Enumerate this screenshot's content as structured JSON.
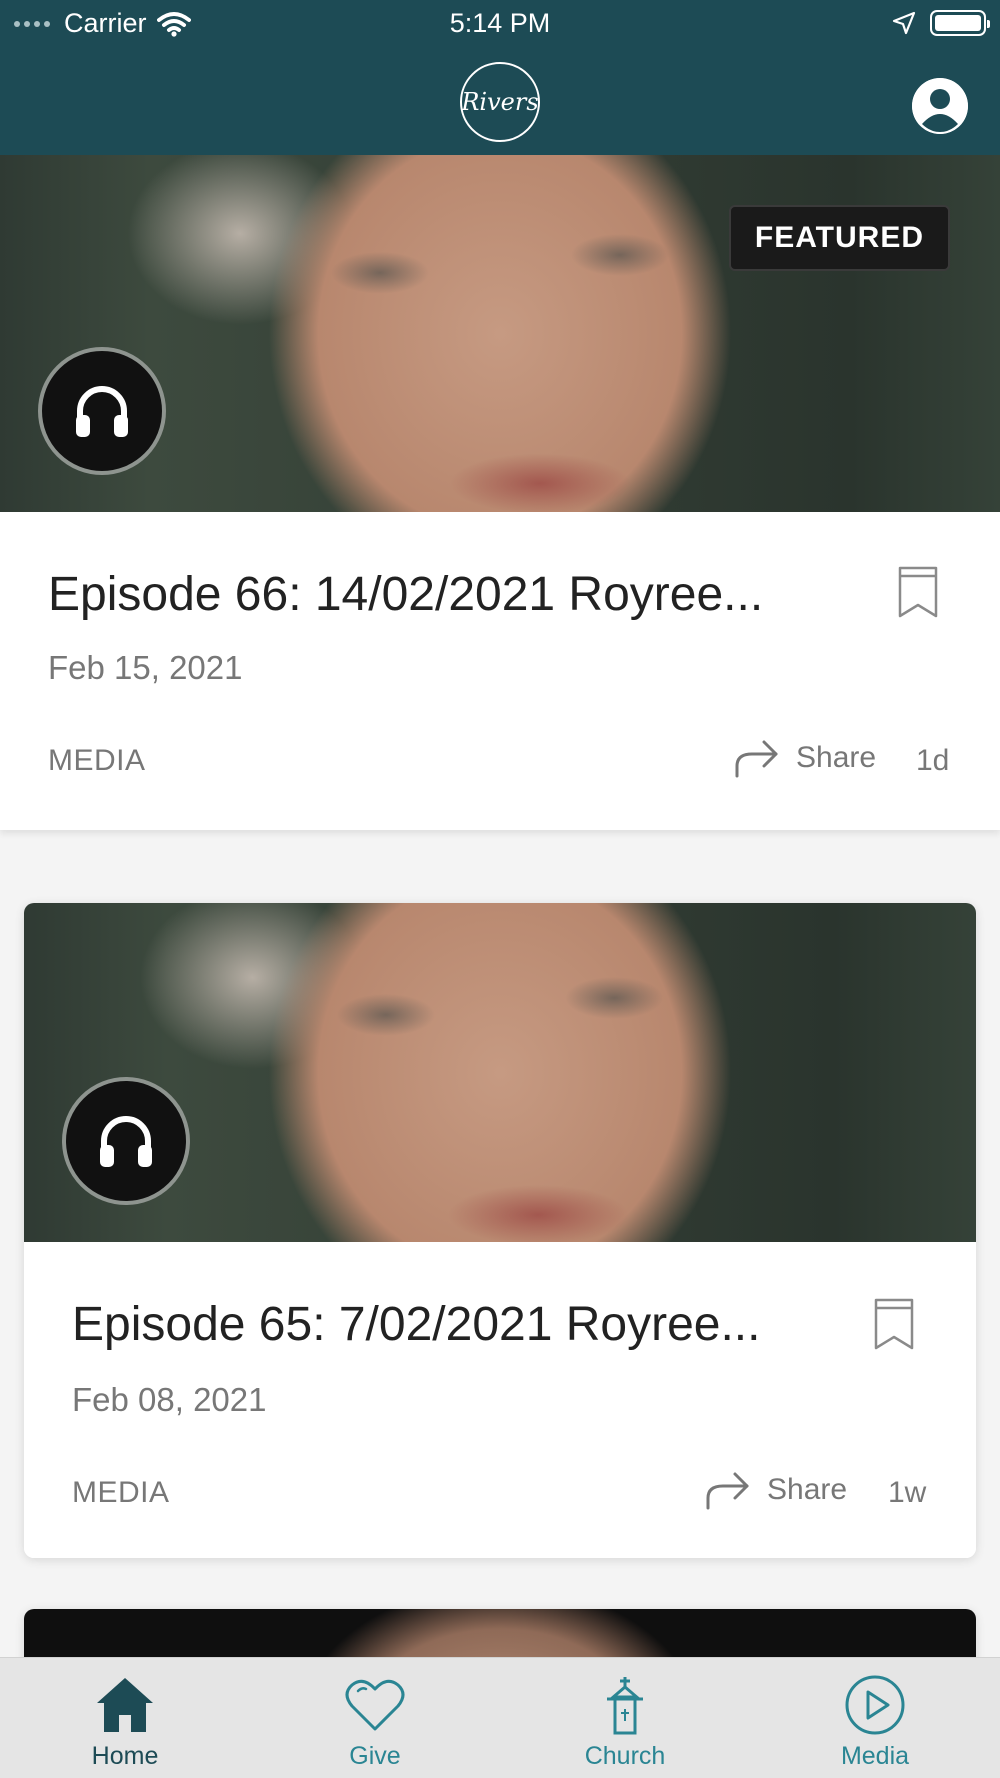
{
  "status_bar": {
    "carrier": "Carrier",
    "time": "5:14 PM"
  },
  "header": {
    "logo_text": "Rivers"
  },
  "featured": {
    "badge": "FEATURED",
    "title": "Episode 66: 14/02/2021 Royree...",
    "date": "Feb 15, 2021",
    "category": "MEDIA",
    "share_label": "Share",
    "age": "1d"
  },
  "cards": [
    {
      "title": "Episode 65: 7/02/2021 Royree...",
      "date": "Feb 08, 2021",
      "category": "MEDIA",
      "share_label": "Share",
      "age": "1w"
    }
  ],
  "tabs": [
    {
      "label": "Home",
      "icon": "home-icon",
      "active": true
    },
    {
      "label": "Give",
      "icon": "heart-icon",
      "active": false
    },
    {
      "label": "Church",
      "icon": "church-icon",
      "active": false
    },
    {
      "label": "Media",
      "icon": "play-circle-icon",
      "active": false
    }
  ],
  "colors": {
    "header_bg": "#1d4b55",
    "tab_active": "#1d4b55",
    "tab_inactive": "#2a8593",
    "tabbar_bg": "#e5e5e5"
  }
}
